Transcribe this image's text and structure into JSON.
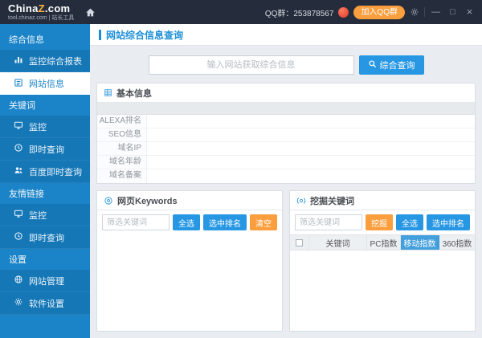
{
  "titlebar": {
    "logo_china": "China",
    "logo_z": "Z",
    "logo_com": ".com",
    "logo_sub": "tool.chinaz.com | 站长工具",
    "qq_label": "QQ群：253878567",
    "join_qq_label": "加入QQ群",
    "icons": {
      "minimize": "—",
      "maximize": "□",
      "close": "×"
    }
  },
  "sidebar": {
    "items": [
      {
        "type": "category",
        "label": "综合信息"
      },
      {
        "type": "item",
        "label": "监控综合报表",
        "icon": "chart-icon"
      },
      {
        "type": "item",
        "label": "网站信息",
        "icon": "document-icon",
        "active": true
      },
      {
        "type": "category",
        "label": "关键词"
      },
      {
        "type": "item",
        "label": "监控",
        "icon": "monitor-icon"
      },
      {
        "type": "item",
        "label": "即时查询",
        "icon": "clock-icon"
      },
      {
        "type": "item",
        "label": "百度即时查询",
        "icon": "users-icon"
      },
      {
        "type": "category",
        "label": "友情链接"
      },
      {
        "type": "item",
        "label": "监控",
        "icon": "monitor-icon"
      },
      {
        "type": "item",
        "label": "即时查询",
        "icon": "clock-icon"
      },
      {
        "type": "category",
        "label": "设置"
      },
      {
        "type": "item",
        "label": "网站管理",
        "icon": "globe-icon"
      },
      {
        "type": "item",
        "label": "软件设置",
        "icon": "gear-icon"
      }
    ]
  },
  "main": {
    "page_title": "网站综合信息查询",
    "search": {
      "placeholder": "输入网站获取综合信息",
      "button": "综合查询"
    },
    "basic_info": {
      "title": "基本信息",
      "rows": [
        "ALEXA排名",
        "SEO信息",
        "域名IP",
        "域名年龄",
        "域名备案"
      ]
    },
    "keywords_panel": {
      "title": "网页Keywords",
      "filter_placeholder": "筛选关键词",
      "buttons": {
        "select_all": "全选",
        "selected_rank": "选中排名",
        "clear": "清空"
      }
    },
    "mining_panel": {
      "title": "挖掘关键词",
      "filter_placeholder": "筛选关键词",
      "buttons": {
        "mine": "挖掘",
        "select_all": "全选",
        "selected_rank": "选中排名"
      },
      "table_headers": [
        "关键词",
        "PC指数",
        "移动指数",
        "360指数"
      ]
    },
    "colors": {
      "accent_blue": "#2797e4",
      "accent_orange": "#fb9e3d",
      "sidebar_blue": "#1b84c8",
      "titlebar_dark": "#252d3c"
    }
  }
}
